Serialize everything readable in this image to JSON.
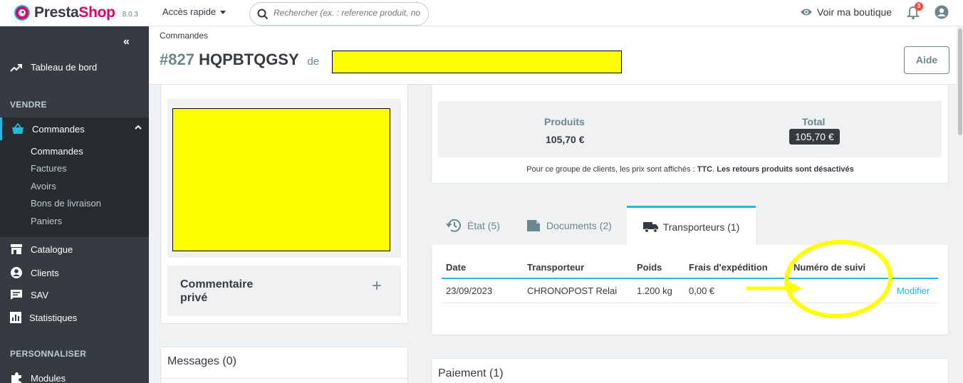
{
  "app": {
    "brand_presta": "Presta",
    "brand_shop": "Shop",
    "version": "8.0.3"
  },
  "header": {
    "quick_access": "Accès rapide",
    "search_placeholder": "Rechercher (ex. : reference produit, no",
    "view_shop": "Voir ma boutique",
    "notifications_count": "3"
  },
  "sidebar": {
    "dashboard": "Tableau de bord",
    "section_sell": "VENDRE",
    "orders": "Commandes",
    "submenu": [
      "Commandes",
      "Factures",
      "Avoirs",
      "Bons de livraison",
      "Paniers"
    ],
    "catalog": "Catalogue",
    "customers": "Clients",
    "sav": "SAV",
    "stats": "Statistiques",
    "section_customize": "PERSONNALISER",
    "modules": "Modules"
  },
  "page": {
    "breadcrumb": "Commandes",
    "order_number": "#827",
    "order_ref": "HQPBTQGSY",
    "from_label": "de",
    "help_button": "Aide"
  },
  "left": {
    "private_comment": "Commentaire privé",
    "messages_title": "Messages (0)"
  },
  "totals": {
    "products_label": "Produits",
    "products_value": "105,70 €",
    "total_label": "Total",
    "total_value": "105,70 €",
    "note_prefix": "Pour ce groupe de clients, les prix sont affichés : ",
    "note_ttc": "TTC",
    "note_returns": "Les retours produits sont désactivés"
  },
  "tabs": {
    "state": "État (5)",
    "documents": "Documents (2)",
    "carriers": "Transporteurs (1)"
  },
  "carrier_table": {
    "headers": [
      "Date",
      "Transporteur",
      "Poids",
      "Frais d'expédition",
      "Numéro de suivi"
    ],
    "row": [
      "23/09/2023",
      "CHRONOPOST Relai",
      "1.200 kg",
      "0,00 €",
      ""
    ],
    "action": "Modifier"
  },
  "payment": {
    "title": "Paiement (1)"
  },
  "colors": {
    "accent": "#25b9d7",
    "brand": "#df0067",
    "sidebar": "#363a41",
    "annotation": "#ffff00"
  }
}
